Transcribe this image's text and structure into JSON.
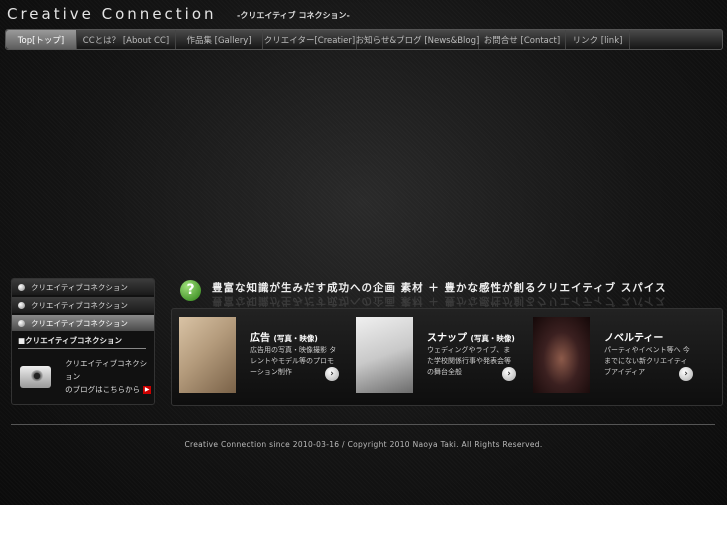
{
  "header": {
    "title": "Creative Connection",
    "subtitle": "-クリエイティブ コネクション-"
  },
  "nav": {
    "items": [
      {
        "label": "Top[トップ]",
        "active": true
      },
      {
        "label": "CCとは？ [About CC]",
        "active": false
      },
      {
        "label": "作品集 [Gallery]",
        "active": false
      },
      {
        "label": "クリエイター[Creatier]",
        "active": false
      },
      {
        "label": "お知らせ&ブログ [News&Blog]",
        "active": false
      },
      {
        "label": "お問合せ [Contact]",
        "active": false
      },
      {
        "label": "リンク [link]",
        "active": false
      }
    ]
  },
  "sidebar": {
    "items": [
      {
        "label": "クリエイティブコネクション"
      },
      {
        "label": "クリエイティブコネクション"
      },
      {
        "label": "クリエイティブコネクション"
      }
    ],
    "section_title": "■クリエイティブコネクション",
    "promo_line1": "クリエイティブコネクション",
    "promo_line2": "のブログはこちらから"
  },
  "tagline": "豊富な知識が生みだす成功への企画 素材 ＋ 豊かな感性が創るクリエイティブ スパイス",
  "features": [
    {
      "title": "広告",
      "title_small": "(写真・映像)",
      "desc": "広告用の写真・映像撮影 タレントやモデル等のプロモーション制作",
      "thumb_color": "#b49b7c"
    },
    {
      "title": "スナップ",
      "title_small": "(写真・映像)",
      "desc": "ウェディングやライブ、また学校関係行事や発表会等の舞台全般",
      "thumb_color": "#c9c9c9"
    },
    {
      "title": "ノベルティー",
      "title_small": "",
      "desc": "パーティやイベント等へ 今までにない新クリエイティブアイディア",
      "thumb_color": "#3b2020"
    }
  ],
  "footer": {
    "copyright": "Creative Connection since 2010-03-16 / Copyright 2010 Naoya Taki. All Rights Reserved."
  }
}
